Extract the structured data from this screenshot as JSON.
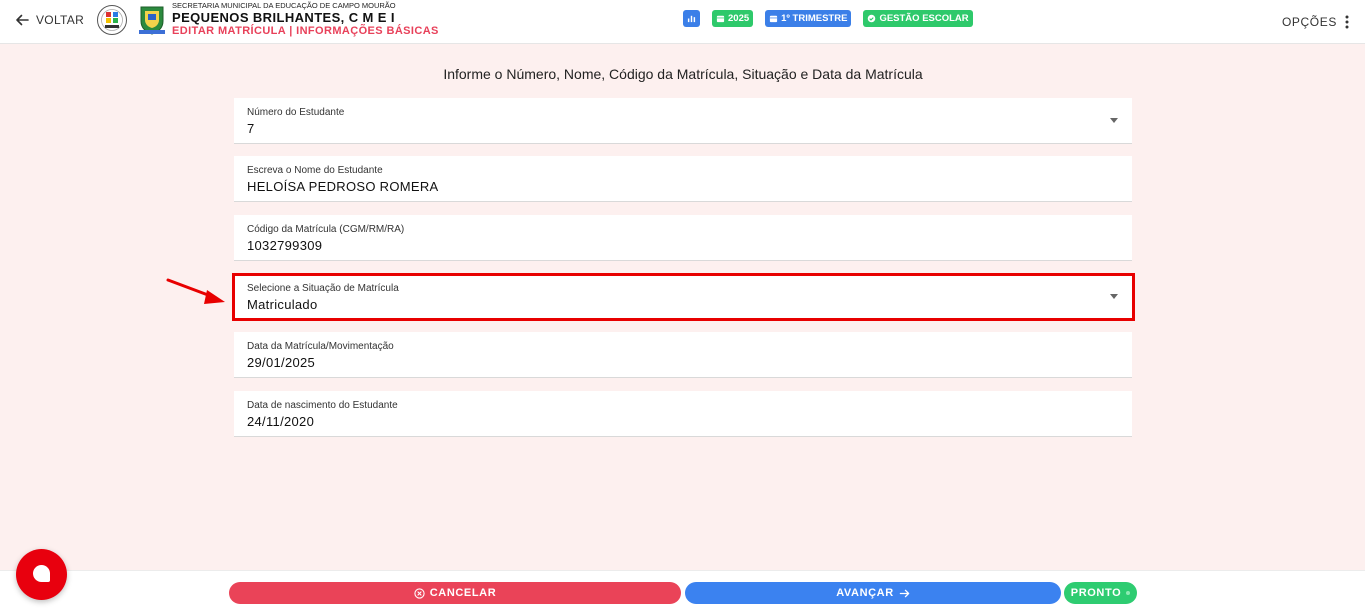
{
  "header": {
    "back_label": "VOLTAR",
    "department": "SECRETARIA MUNICIPAL DA EDUCAÇÃO DE CAMPO MOURÃO",
    "school": "PEQUENOS BRILHANTES, C M E I",
    "subtitle": "EDITAR MATRÍCULA | INFORMAÇÕES BÁSICAS",
    "badges": {
      "year": "2025",
      "term": "1º TRIMESTRE",
      "management": "GESTÃO ESCOLAR"
    },
    "options_label": "OPÇÕES"
  },
  "form": {
    "heading": "Informe o Número, Nome, Código da Matrícula, Situação e Data da Matrícula",
    "student_number": {
      "label": "Número do Estudante",
      "value": "7"
    },
    "student_name": {
      "label": "Escreva o Nome do Estudante",
      "value": "HELOÍSA PEDROSO ROMERA"
    },
    "enrollment_code": {
      "label": "Código da Matrícula (CGM/RM/RA)",
      "value": "1032799309"
    },
    "enrollment_status": {
      "label": "Selecione a Situação de Matrícula",
      "value": "Matriculado"
    },
    "enrollment_date": {
      "label": "Data da Matrícula/Movimentação",
      "value": "29/01/2025"
    },
    "birth_date": {
      "label": "Data de nascimento do Estudante",
      "value": "24/11/2020"
    }
  },
  "footer": {
    "cancel_label": "CANCELAR",
    "next_label": "AVANÇAR",
    "done_label": "PRONTO"
  },
  "colors": {
    "accent_red": "#ea4358",
    "accent_blue": "#3b82f0",
    "accent_green": "#2ecc71",
    "highlight": "#e80000",
    "background": "#fdf0ef"
  }
}
